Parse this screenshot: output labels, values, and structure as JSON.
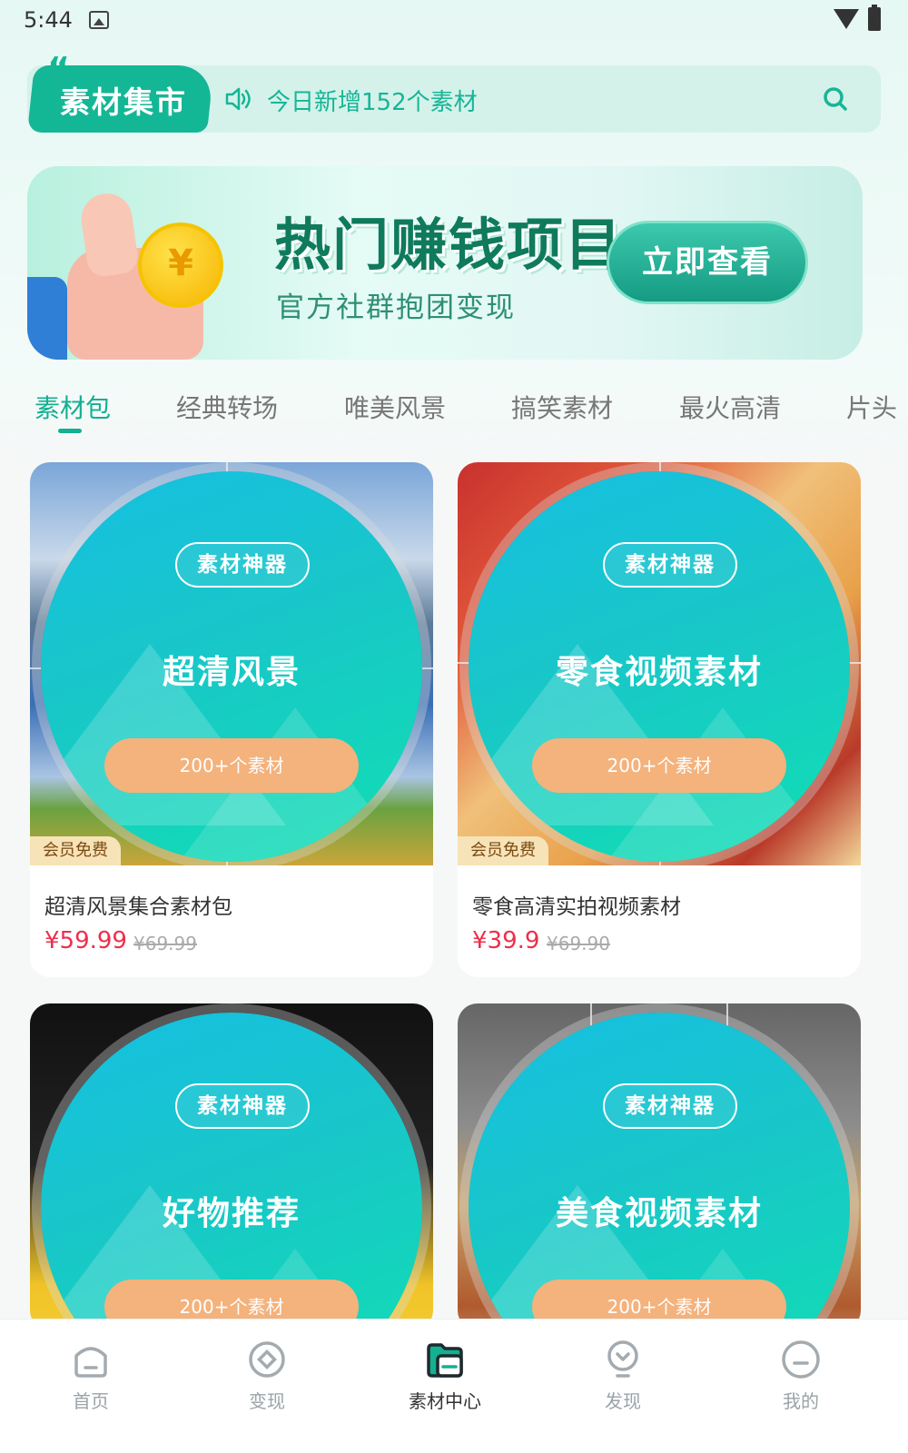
{
  "status_bar": {
    "time": "5:44"
  },
  "header": {
    "brand": "素材集市",
    "notice": "今日新增152个素材"
  },
  "banner": {
    "title": "热门赚钱项目",
    "subtitle": "官方社群抱团变现",
    "button": "立即查看",
    "coin_symbol": "¥"
  },
  "tabs": [
    {
      "label": "素材包",
      "active": true
    },
    {
      "label": "经典转场",
      "active": false
    },
    {
      "label": "唯美风景",
      "active": false
    },
    {
      "label": "搞笑素材",
      "active": false
    },
    {
      "label": "最火高清",
      "active": false
    },
    {
      "label": "片头",
      "active": false
    }
  ],
  "cards": [
    {
      "badge": "素材神器",
      "overlay_title": "超清风景",
      "count": "200+个素材",
      "member": "会员免费",
      "title": "超清风景集合素材包",
      "price": "¥59.99",
      "orig_price": "¥69.99"
    },
    {
      "badge": "素材神器",
      "overlay_title": "零食视频素材",
      "count": "200+个素材",
      "member": "会员免费",
      "title": "零食高清实拍视频素材",
      "price": "¥39.9",
      "orig_price": "¥69.90"
    },
    {
      "badge": "素材神器",
      "overlay_title": "好物推荐",
      "count": "200+个素材"
    },
    {
      "badge": "素材神器",
      "overlay_title": "美食视频素材",
      "count": "200+个素材"
    }
  ],
  "bottom_nav": [
    {
      "label": "首页",
      "icon": "home-icon",
      "active": false
    },
    {
      "label": "变现",
      "icon": "target-icon",
      "active": false
    },
    {
      "label": "素材中心",
      "icon": "folder-icon",
      "active": true
    },
    {
      "label": "发现",
      "icon": "bulb-icon",
      "active": false
    },
    {
      "label": "我的",
      "icon": "profile-icon",
      "active": false
    }
  ],
  "colors": {
    "accent": "#13b091",
    "price": "#ee2e4b",
    "count_pill": "#f4b27c"
  }
}
